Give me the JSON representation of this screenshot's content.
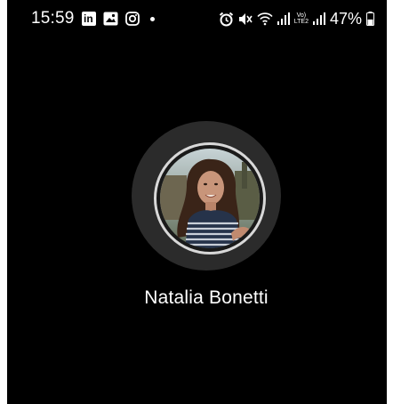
{
  "status_bar": {
    "time": "15:59",
    "battery_percent": "47%",
    "network_badge": [
      "Vo)",
      "LTE2"
    ],
    "left_icons": [
      "linkedin-icon",
      "gallery-icon",
      "instagram-icon",
      "notification-dot-icon"
    ],
    "right_icons": [
      "alarm-icon",
      "mute-icon",
      "wifi-icon",
      "signal-icon",
      "lte-badge-icon",
      "signal-icon",
      "battery-icon"
    ],
    "battery_level": 0.47
  },
  "contact": {
    "name": "Natalia Bonetti",
    "avatar": "contact-photo"
  },
  "colors": {
    "background": "#000000",
    "halo": "#2b2b2b",
    "ring": "#d8d8d8",
    "text": "#ffffff"
  }
}
